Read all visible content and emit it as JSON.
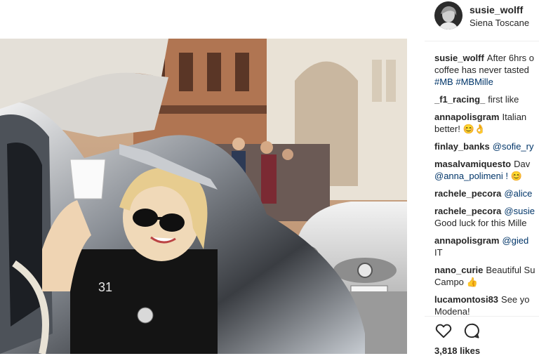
{
  "post": {
    "username": "susie_wolff",
    "location": "Siena Toscane"
  },
  "comments": [
    {
      "user": "susie_wolff",
      "lines": [
        "After 6hrs o",
        "coffee has never tasted",
        "#MB #MBMille"
      ]
    },
    {
      "user": "_f1_racing_",
      "lines": [
        "first like"
      ]
    },
    {
      "user": "annapolisgram",
      "lines": [
        "Italian",
        "better! 😊👌"
      ]
    },
    {
      "user": "finlay_banks",
      "lines": [
        "@sofie_ry"
      ]
    },
    {
      "user": "masalvamiquesto",
      "lines": [
        "Dav",
        "@anna_polimeni ! 😊"
      ]
    },
    {
      "user": "rachele_pecora",
      "lines": [
        "@alice"
      ]
    },
    {
      "user": "rachele_pecora",
      "lines": [
        "@susie",
        "Good luck for this Mille"
      ]
    },
    {
      "user": "annapolisgram",
      "lines": [
        "@gied",
        "IT"
      ]
    },
    {
      "user": "nano_curie",
      "lines": [
        "Beautiful Su",
        "Campo 👍"
      ]
    },
    {
      "user": "lucamontosi83",
      "lines": [
        "See yo",
        "Modena!"
      ]
    }
  ],
  "actions": {
    "like_icon": "heart-outline-icon",
    "comment_icon": "speech-bubble-icon"
  },
  "likes": "3,818 likes",
  "colors": {
    "text": "#262626",
    "link": "#003569",
    "divider": "#efefef"
  }
}
